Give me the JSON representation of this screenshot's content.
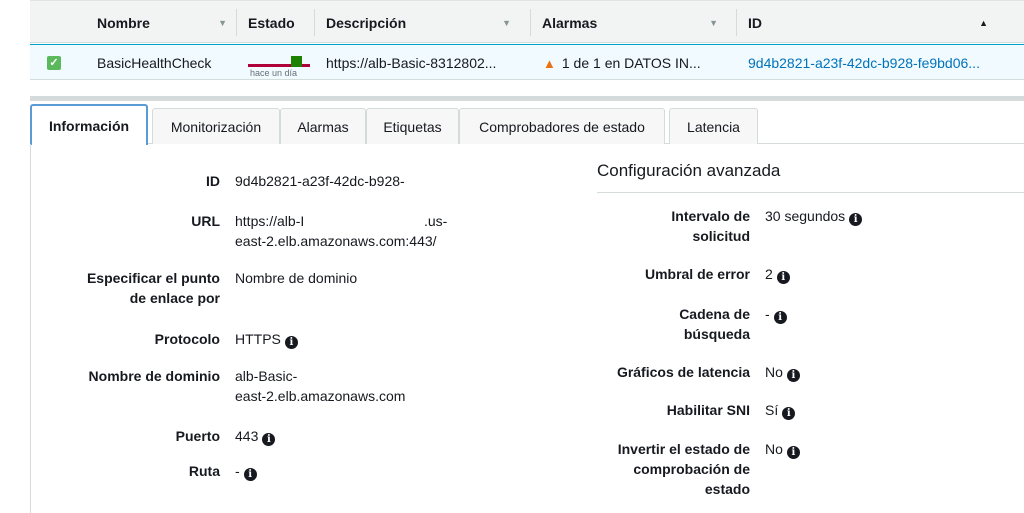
{
  "table": {
    "columns": {
      "nombre": "Nombre",
      "estado": "Estado",
      "descripcion": "Descripción",
      "alarmas": "Alarmas",
      "id": "ID"
    },
    "row": {
      "nombre": "BasicHealthCheck",
      "estado_label": "hace un día",
      "descripcion": "https://alb-Basic-8312802...",
      "alarmas": "1 de 1 en DATOS IN...",
      "id": "9d4b2821-a23f-42dc-b928-fe9bd06..."
    }
  },
  "tabs": [
    {
      "label": "Información"
    },
    {
      "label": "Monitorización"
    },
    {
      "label": "Alarmas"
    },
    {
      "label": "Etiquetas"
    },
    {
      "label": "Comprobadores de estado"
    },
    {
      "label": "Latencia"
    }
  ],
  "details": {
    "id_label": "ID",
    "id_value": "9d4b2821-a23f-42dc-b928-",
    "url_label": "URL",
    "url_value_1": "https://alb-I",
    "url_value_1b": ".us-",
    "url_value_2": "east-2.elb.amazonaws.com:443/",
    "endpoint_label_1": "Especificar el punto",
    "endpoint_label_2": "de enlace por",
    "endpoint_value": "Nombre de dominio",
    "protocol_label": "Protocolo",
    "protocol_value": "HTTPS",
    "domain_label": "Nombre de dominio",
    "domain_value_1": "alb-Basic-",
    "domain_value_2": "east-2.elb.amazonaws.com",
    "port_label": "Puerto",
    "port_value": "443",
    "path_label": "Ruta",
    "path_value": "-"
  },
  "advanced": {
    "title": "Configuración avanzada",
    "interval_label_1": "Intervalo de",
    "interval_label_2": "solicitud",
    "interval_value": "30 segundos",
    "threshold_label": "Umbral de error",
    "threshold_value": "2",
    "search_label_1": "Cadena de",
    "search_label_2": "búsqueda",
    "search_value": "-",
    "latency_label": "Gráficos de latencia",
    "latency_value": "No",
    "sni_label": "Habilitar SNI",
    "sni_value": "Sí",
    "invert_label_1": "Invertir el estado de",
    "invert_label_2": "comprobación de",
    "invert_label_3": "estado",
    "invert_value": "No"
  },
  "colors": {
    "selected_row": "#f1faff",
    "link": "#0073bb",
    "warning": "#ec7211",
    "status_green": "#1d8102",
    "status_red": "#b0003a"
  },
  "icons": {
    "info": "info-icon",
    "warning": "warning-icon",
    "sort": "sort-arrow-icon",
    "checkbox": "checkbox-checked-icon"
  }
}
